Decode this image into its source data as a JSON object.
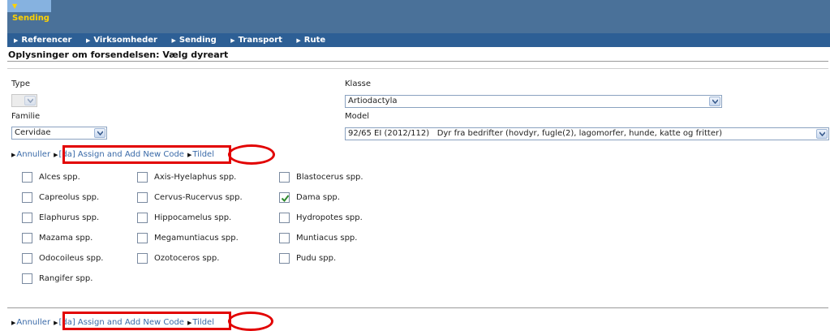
{
  "header": {
    "active_tab": "Sending",
    "nav": [
      "Referencer",
      "Virksomheder",
      "Sending",
      "Transport",
      "Rute"
    ]
  },
  "section_title": "Oplysninger om forsendelsen: Vælg dyreart",
  "form": {
    "type_label": "Type",
    "type_value": "",
    "klasse_label": "Klasse",
    "klasse_value": "Artiodactyla",
    "familie_label": "Familie",
    "familie_value": "Cervidae",
    "model_label": "Model",
    "model_value": "92/65 EI (2012/112)   Dyr fra bedrifter (hovdyr, fugle(2), lagomorfer, hunde, katte og fritter)"
  },
  "actions": {
    "cancel": "Annuller",
    "assign_new": "[da] Assign and Add New Code",
    "assign": "Tildel"
  },
  "species": [
    {
      "label": "Alces spp.",
      "checked": false
    },
    {
      "label": "Axis-Hyelaphus spp.",
      "checked": false
    },
    {
      "label": "Blastocerus spp.",
      "checked": false
    },
    {
      "label": "Capreolus spp.",
      "checked": false
    },
    {
      "label": "Cervus-Rucervus spp.",
      "checked": false
    },
    {
      "label": "Dama spp.",
      "checked": true
    },
    {
      "label": "Elaphurus spp.",
      "checked": false
    },
    {
      "label": "Hippocamelus spp.",
      "checked": false
    },
    {
      "label": "Hydropotes spp.",
      "checked": false
    },
    {
      "label": "Mazama spp.",
      "checked": false
    },
    {
      "label": "Megamuntiacus spp.",
      "checked": false
    },
    {
      "label": "Muntiacus spp.",
      "checked": false
    },
    {
      "label": "Odocoileus spp.",
      "checked": false
    },
    {
      "label": "Ozotoceros spp.",
      "checked": false
    },
    {
      "label": "Pudu spp.",
      "checked": false
    },
    {
      "label": "Rangifer spp.",
      "checked": false
    }
  ],
  "colors": {
    "nav_bar": "#2d5f95",
    "active_tab": "#86b2e0",
    "active_tab_text": "#ffd200",
    "link": "#3a6aa8",
    "annotation": "#e20000",
    "check": "#2e8b2e"
  },
  "icons": {
    "dropdown": "chevron-down-icon",
    "expand_arrow": "triangle-down-icon",
    "link_arrow": "triangle-right-icon",
    "check": "checkmark-icon"
  }
}
